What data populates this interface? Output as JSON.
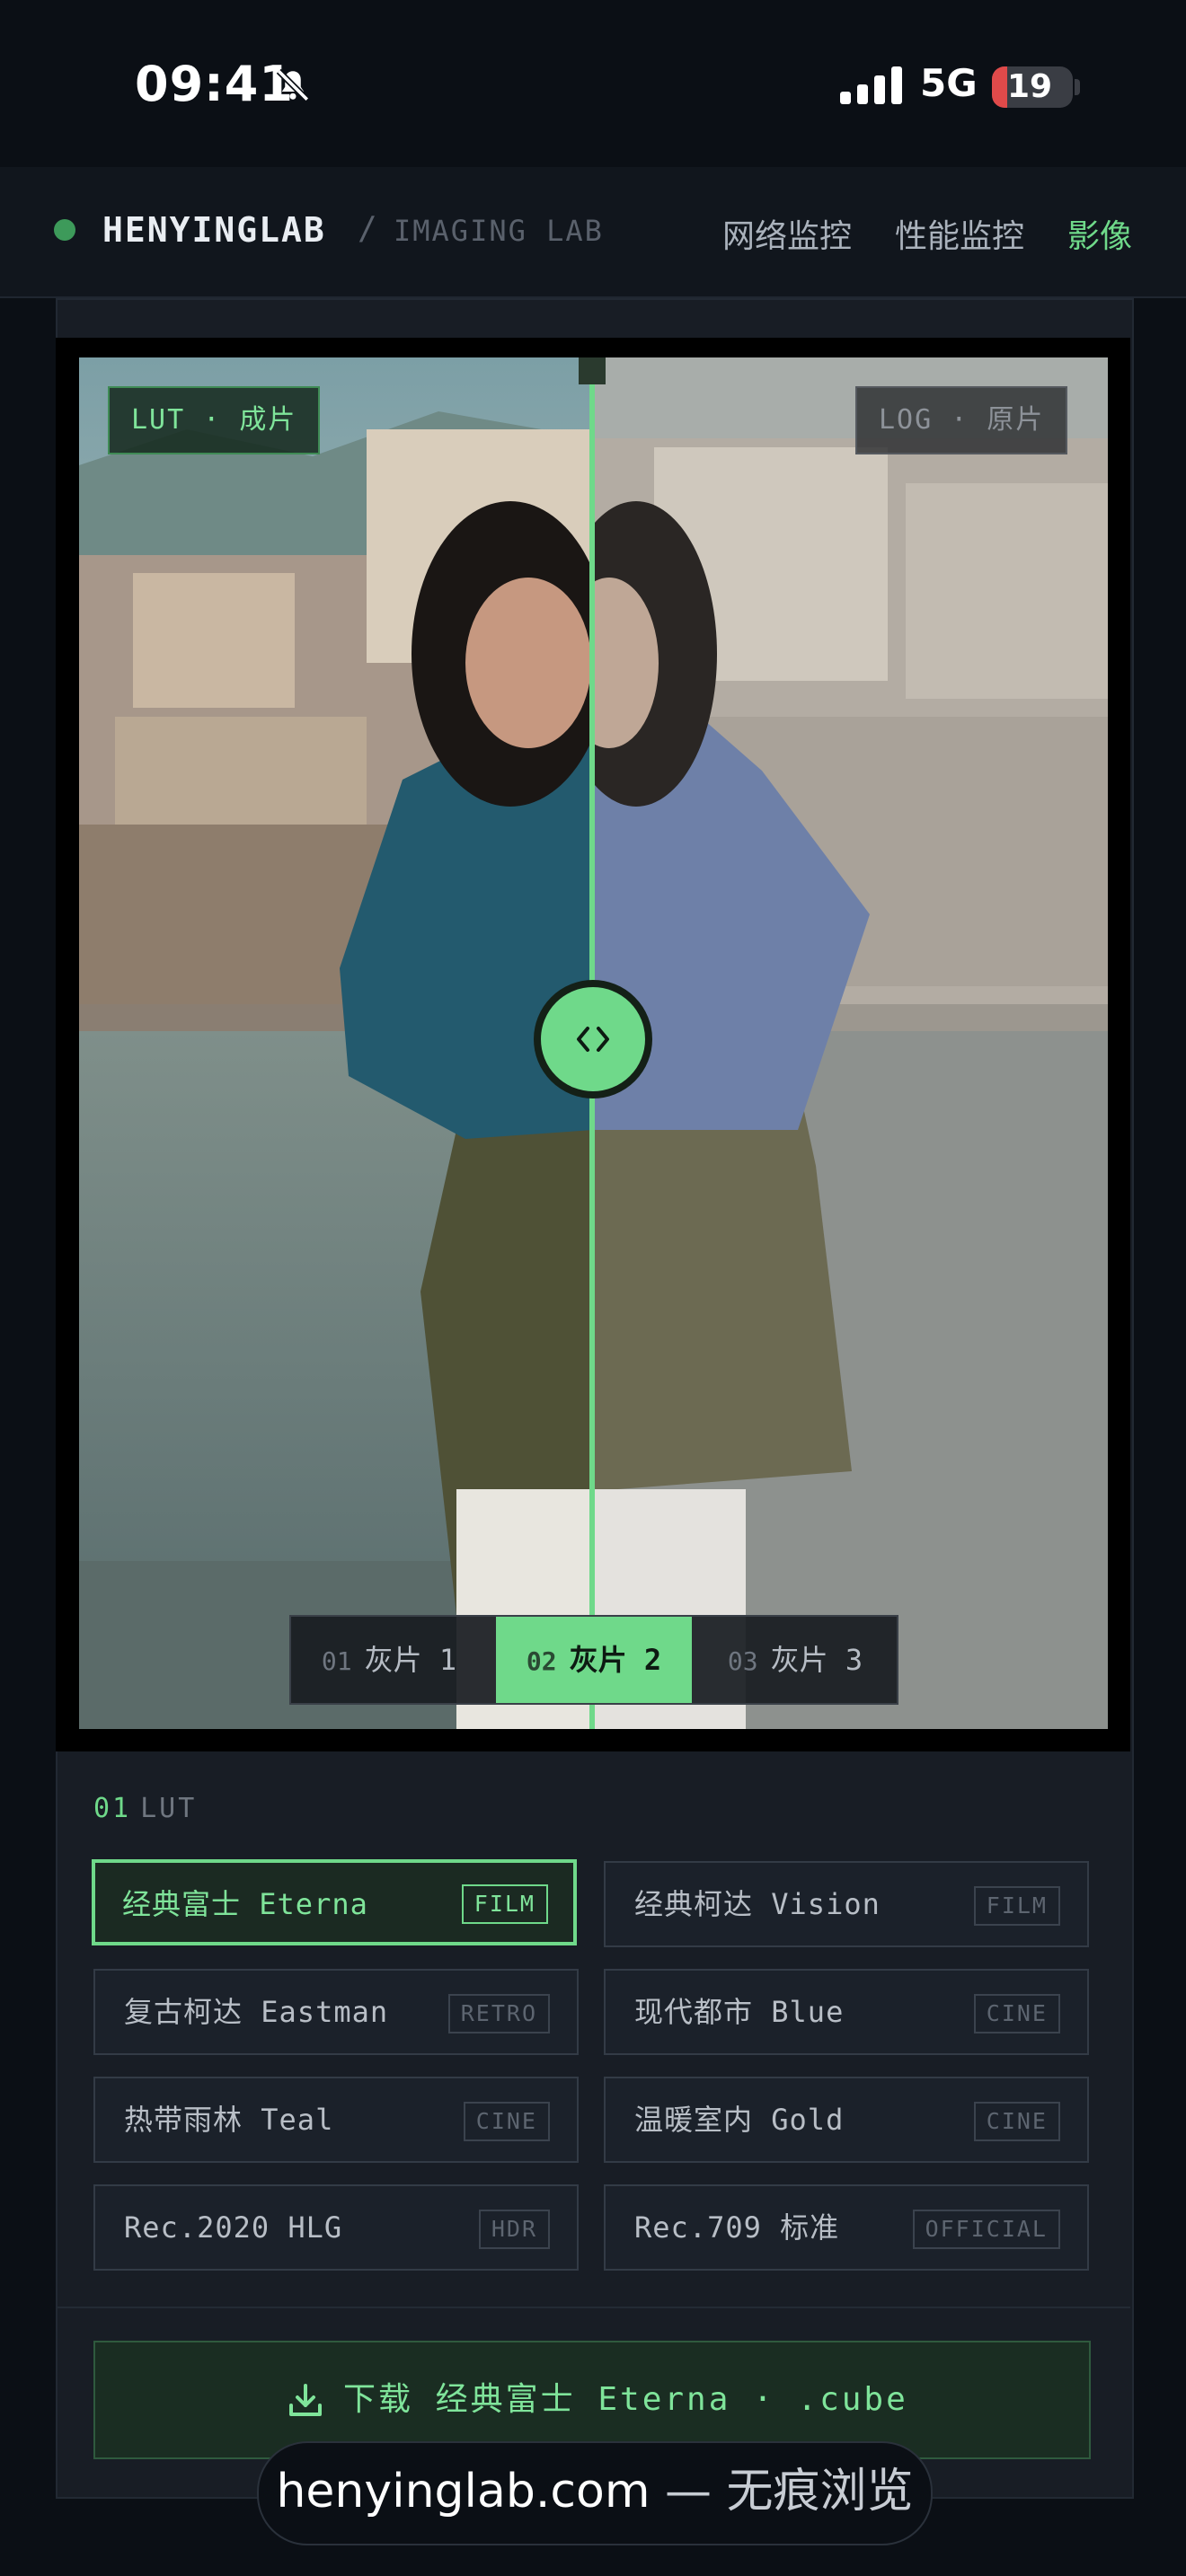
{
  "status_bar": {
    "time": "09:41",
    "network": "5G",
    "battery": "19",
    "battery_level_percent": 19,
    "icons": [
      "bell-slash-icon",
      "signal-bars-icon",
      "battery-icon"
    ]
  },
  "header": {
    "brand": "HENYINGLAB",
    "separator": "/",
    "subtitle": "IMAGING LAB",
    "nav": [
      {
        "label": "网络监控",
        "active": false
      },
      {
        "label": "性能监控",
        "active": false
      },
      {
        "label": "影像",
        "active": true
      }
    ]
  },
  "viewer": {
    "left_tag": "LUT · 成片",
    "right_tag": "LOG · 原片",
    "split_position_fraction": 0.5,
    "handle_icon": "chevrons-left-right-icon",
    "gray_tabs": [
      {
        "num": "01",
        "label": "灰片 1",
        "active": false
      },
      {
        "num": "02",
        "label": "灰片 2",
        "active": true
      },
      {
        "num": "03",
        "label": "灰片 3",
        "active": false
      }
    ]
  },
  "lut_section": {
    "num": "01",
    "title": "LUT",
    "items": [
      {
        "name": "经典富士 Eterna",
        "badge": "FILM",
        "active": true
      },
      {
        "name": "经典柯达 Vision",
        "badge": "FILM",
        "active": false
      },
      {
        "name": "复古柯达 Eastman",
        "badge": "RETRO",
        "active": false
      },
      {
        "name": "现代都市 Blue",
        "badge": "CINE",
        "active": false
      },
      {
        "name": "热带雨林 Teal",
        "badge": "CINE",
        "active": false
      },
      {
        "name": "温暖室内 Gold",
        "badge": "CINE",
        "active": false
      },
      {
        "name": "Rec.2020 HLG",
        "badge": "HDR",
        "active": false
      },
      {
        "name": "Rec.709 标准",
        "badge": "OFFICIAL",
        "active": false
      }
    ]
  },
  "download": {
    "label": "下载 经典富士 Eterna · .cube",
    "icon": "download-icon"
  },
  "browser": {
    "domain": "henyinglab.com",
    "mode": " — 无痕浏览"
  },
  "colors": {
    "accent": "#6fd98a",
    "background": "#0b0f15",
    "card": "#181d25"
  }
}
